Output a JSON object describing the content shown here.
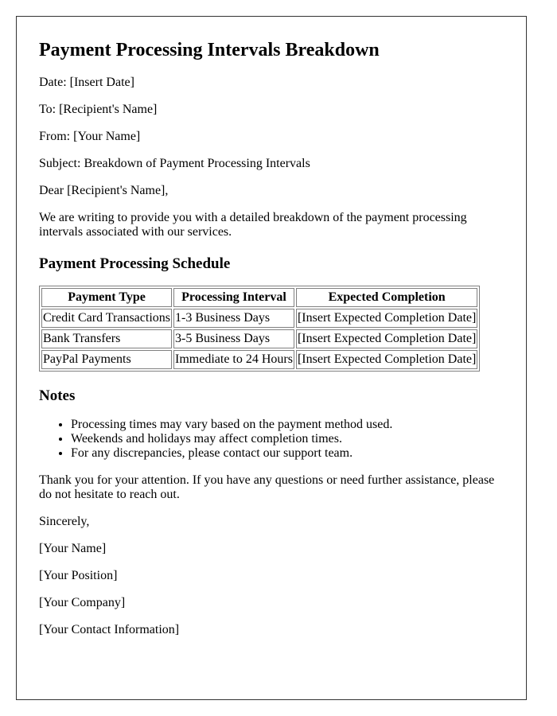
{
  "document": {
    "title": "Payment Processing Intervals Breakdown",
    "header_lines": [
      "Date: [Insert Date]",
      "To: [Recipient's Name]",
      "From: [Your Name]",
      "Subject: Breakdown of Payment Processing Intervals"
    ],
    "salutation": "Dear [Recipient's Name],",
    "intro": "We are writing to provide you with a detailed breakdown of the payment processing intervals associated with our services.",
    "schedule": {
      "heading": "Payment Processing Schedule",
      "columns": [
        "Payment Type",
        "Processing Interval",
        "Expected Completion"
      ],
      "rows": [
        [
          "Credit Card Transactions",
          "1-3 Business Days",
          "[Insert Expected Completion Date]"
        ],
        [
          "Bank Transfers",
          "3-5 Business Days",
          "[Insert Expected Completion Date]"
        ],
        [
          "PayPal Payments",
          "Immediate to 24 Hours",
          "[Insert Expected Completion Date]"
        ]
      ]
    },
    "notes": {
      "heading": "Notes",
      "items": [
        "Processing times may vary based on the payment method used.",
        "Weekends and holidays may affect completion times.",
        "For any discrepancies, please contact our support team."
      ]
    },
    "closing_paragraph": "Thank you for your attention. If you have any questions or need further assistance, please do not hesitate to reach out.",
    "signoff": "Sincerely,",
    "signature_lines": [
      "[Your Name]",
      "[Your Position]",
      "[Your Company]",
      "[Your Contact Information]"
    ]
  }
}
